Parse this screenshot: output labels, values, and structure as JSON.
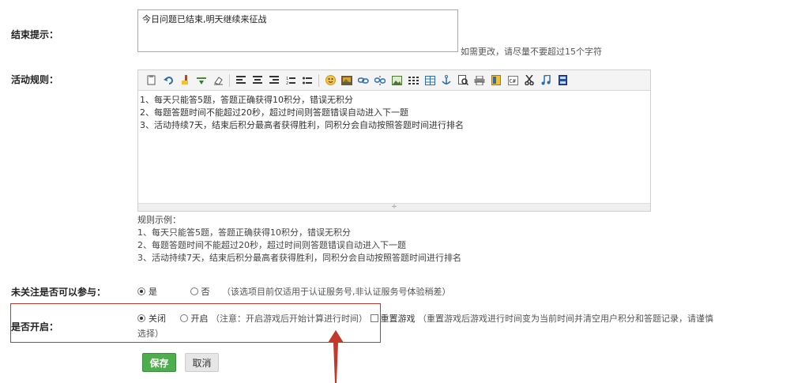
{
  "end_prompt": {
    "label": "结束提示：",
    "value": "今日问题已结束,明天继续来征战",
    "hint": "如需更改，请尽量不要超过15个字符"
  },
  "rules": {
    "label": "活动规则：",
    "toolbar_icons": [
      "paste-word-icon",
      "undo-icon",
      "format-brush-icon",
      "insert-icon",
      "eraser-icon",
      "align-left-icon",
      "align-center-icon",
      "align-right-icon",
      "ordered-list-icon",
      "unordered-list-icon",
      "emoticon-icon",
      "image-icon",
      "link-icon",
      "unlink-icon",
      "picture-icon",
      "table-dots-icon",
      "table-icon",
      "anchor-icon",
      "preview-icon",
      "print-icon",
      "template-icon",
      "code-icon",
      "cut-icon",
      "music-icon",
      "video-icon"
    ],
    "lines": [
      "1、每天只能答5题，答题正确获得10积分，错误无积分",
      "2、每题答题时间不能超过20秒，超过时间则答题错误自动进入下一题",
      "3、活动持续7天，结束后积分最高者获得胜利，同积分会自动按照答题时间进行排名"
    ],
    "resize_glyph": "÷"
  },
  "example": {
    "title": "规则示例：",
    "lines": [
      "1、每天只能答5题，答题正确获得10积分，错误无积分",
      "2、每题答题时间不能超过20秒，超过时间则答题错误自动进入下一题",
      "3、活动持续7天，结束后积分最高者获得胜利，同积分会自动按照答题时间进行排名"
    ]
  },
  "follow": {
    "label": "未关注是否可以参与：",
    "yes": "是",
    "no": "否",
    "note": "（该选项目前仅适用于认证服务号,非认证服务号体验稍差）"
  },
  "enable": {
    "label": "是否开启：",
    "off": "关闭",
    "on": "开启",
    "on_note": "（注意：开启游戏后开始计算进行时间）",
    "reset": "重置游戏",
    "reset_note": "（重置游戏后游戏进行时间变为当前时间并清空用户积分和答题记录，请谨慎",
    "reset_note_2": "选择）"
  },
  "buttons": {
    "save": "保存",
    "cancel": "取消"
  },
  "colors": {
    "highlight": "#c0392b",
    "save": "#4cae4c"
  }
}
